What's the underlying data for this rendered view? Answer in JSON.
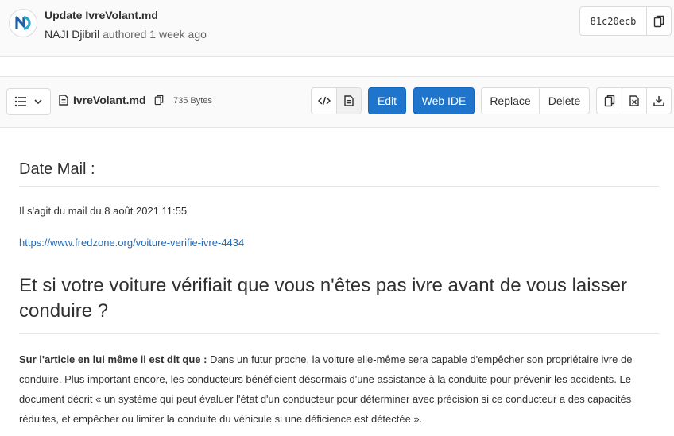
{
  "commit": {
    "title": "Update IvreVolant.md",
    "author": "NAJI Djibril",
    "authored": "authored 1 week ago",
    "sha": "81c20ecb"
  },
  "file": {
    "name": "IvreVolant.md",
    "size": "735 Bytes"
  },
  "toolbar": {
    "edit": "Edit",
    "web_ide": "Web IDE",
    "replace": "Replace",
    "delete": "Delete"
  },
  "content": {
    "date_heading": "Date Mail :",
    "sent_line": "Il s'agit du mail du 8 août 2021 11:55",
    "link": "https://www.fredzone.org/voiture-verifie-ivre-4434",
    "headline": "Et si votre voiture vérifiait que vous n'êtes pas ivre avant de vous laisser conduire ?",
    "lead_bold": "Sur l'article en lui même il est dit que :",
    "body_text": " Dans un futur proche, la voiture elle-même sera capable d'empêcher son propriétaire ivre de conduire. Plus important encore, les conducteurs bénéficient désormais d'une assistance à la conduite pour prévenir les accidents. Le document décrit « un système qui peut évaluer l'état d'un conducteur pour déterminer avec précision si ce conducteur a des capacités réduites, et empêcher ou limiter la conduite du véhicule si une déficience est détectée »."
  },
  "colors": {
    "primary": "#1f75cb",
    "link": "#1f6ab8"
  }
}
